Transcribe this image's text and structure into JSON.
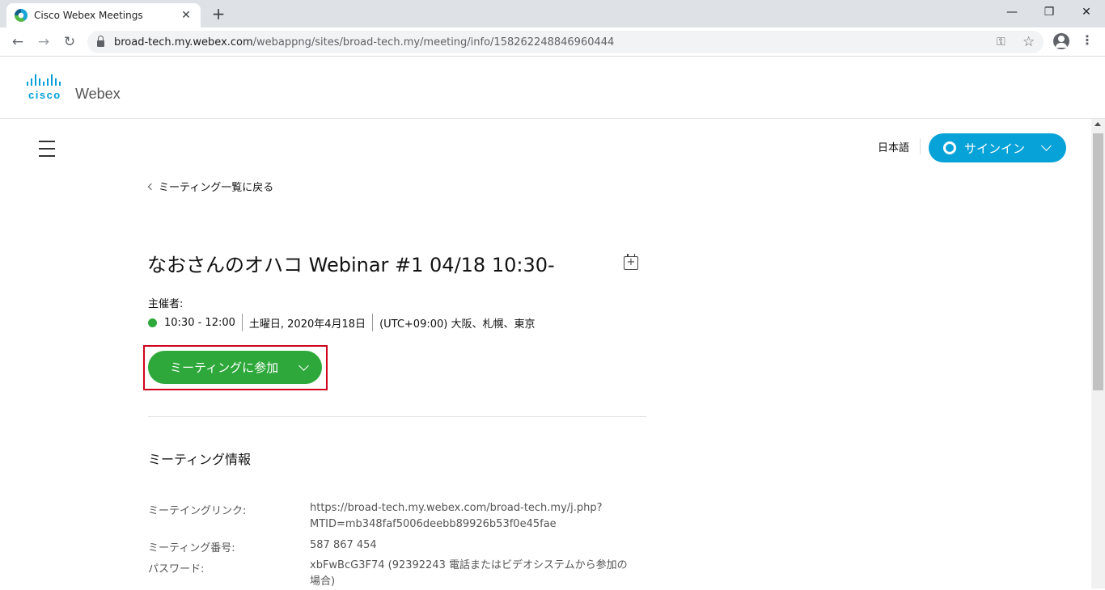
{
  "browser": {
    "tab_title": "Cisco Webex Meetings",
    "tab_close": "✕",
    "new_tab": "+",
    "url_host": "broad-tech.my.webex.com",
    "url_path": "/webappng/sites/broad-tech.my/meeting/info/158262248846960444",
    "minimize": "—",
    "restore": "❐",
    "close": "✕",
    "back": "←",
    "forward": "→",
    "reload": "↻",
    "key": "⚿",
    "star": "☆",
    "menu": "⋮"
  },
  "header": {
    "logo_cisco": "cisco",
    "logo_webex": "Webex",
    "language": "日本語",
    "signin_label": "サインイン"
  },
  "meeting": {
    "back_link": "ミーティング一覧に戻る",
    "title": "なおさんのオハコ Webinar #1 04/18 10:30-",
    "calendar_glyph": "+",
    "host_label": "主催者:",
    "time": "10:30 - 12:00",
    "date": "土曜日, 2020年4月18日",
    "timezone": "(UTC+09:00) 大阪、札幌、東京",
    "join_label": "ミーティングに参加",
    "status_color": "#2ea83b"
  },
  "info": {
    "section_title": "ミーティング情報",
    "link_label": "ミーテイングリンク:",
    "link_value_1": "https://broad-tech.my.webex.com/broad-tech.my/j.php?",
    "link_value_2": "MTID=mb348faf5006deebb89926b53f0e45fae",
    "number_label": "ミーティング番号:",
    "number_value": "587 867 454",
    "password_label": "パスワード:",
    "password_value_1": "xbFwBcG3F74 (92392243 電話またはビデオシステムから参加の",
    "password_value_2": "場合)"
  },
  "colors": {
    "accent": "#07a2d8",
    "join": "#2ea83b",
    "highlight": "#d0021b"
  }
}
